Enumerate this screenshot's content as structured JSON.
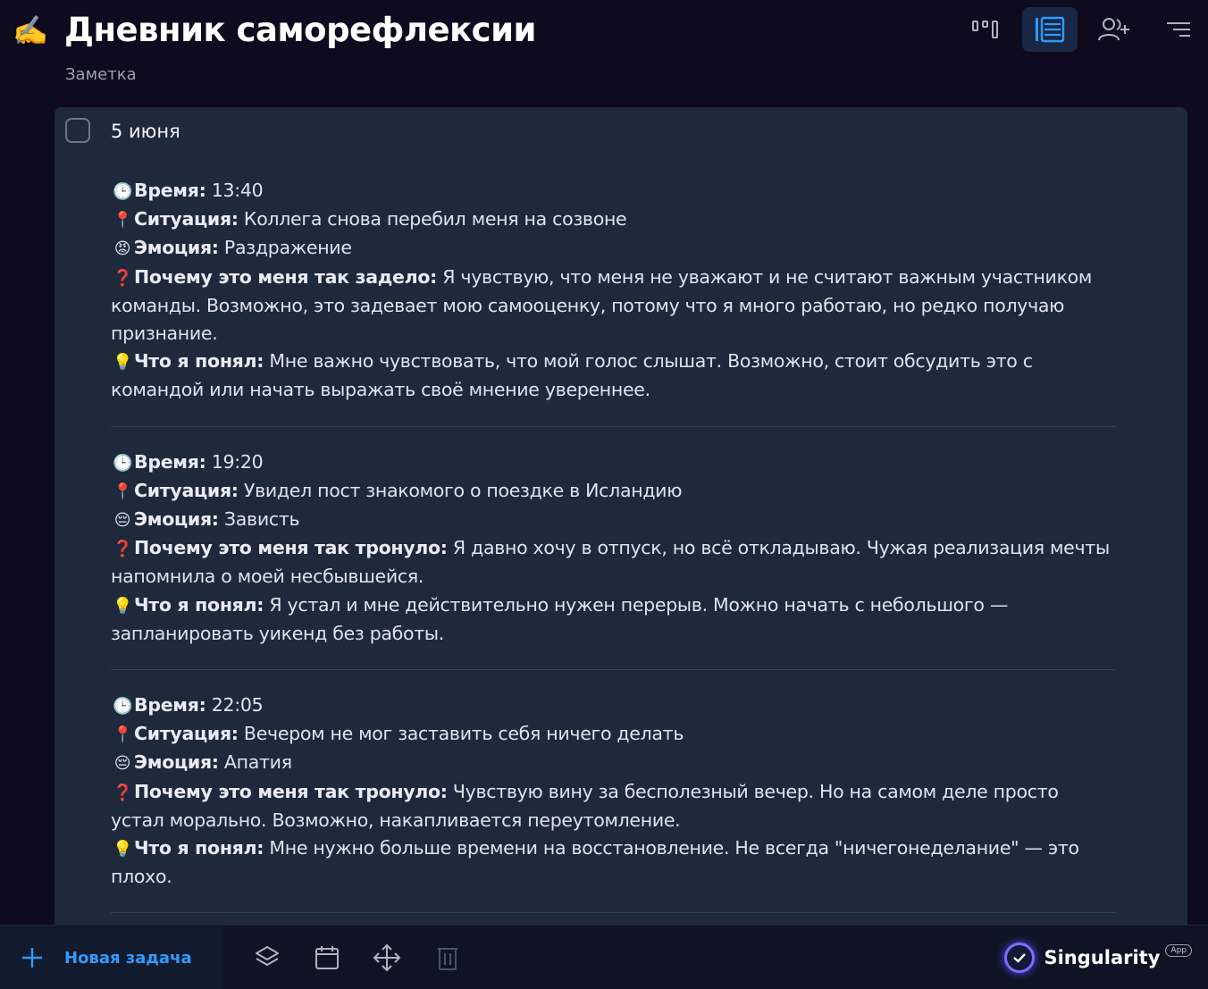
{
  "header": {
    "title_emoji": "✍️",
    "title": "Дневник саморефлексии",
    "subtitle": "Заметка"
  },
  "toolbar": {
    "icons": [
      "kanban-icon",
      "list-view-icon",
      "add-user-icon",
      "sort-icon"
    ],
    "active": "list-view-icon",
    "accent": "#2f9bff"
  },
  "note": {
    "date": "5 июня",
    "entries": [
      {
        "time_emoji": "🕒",
        "time_label": "Время:",
        "time": " 13:40",
        "situation_emoji": "📍",
        "situation_label": "Ситуация:",
        "situation": " Коллега снова перебил меня на созвоне",
        "emotion_emoji": "😡",
        "emotion_label": "Эмоция:",
        "emotion": " Раздражение",
        "why_emoji": "❓",
        "why_label": "Почему это меня так задело:",
        "why": " Я чувствую, что меня не уважают и не считают важным участником команды. Возможно, это задевает мою самооценку, потому что я много работаю, но редко получаю признание.",
        "insight_emoji": "💡",
        "insight_label": "Что я понял:",
        "insight": " Мне важно чувствовать, что мой голос слышат. Возможно, стоит обсудить это с командой или начать выражать своё мнение увереннее."
      },
      {
        "time_emoji": "🕒",
        "time_label": "Время:",
        "time": " 19:20",
        "situation_emoji": "📍",
        "situation_label": "Ситуация:",
        "situation": " Увидел пост знакомого о поездке в Исландию",
        "emotion_emoji": "😔",
        "emotion_label": "Эмоция:",
        "emotion": " Зависть",
        "why_emoji": "❓",
        "why_label": "Почему это меня так тронуло:",
        "why": " Я давно хочу в отпуск, но всё откладываю. Чужая реализация мечты напомнила о моей несбывшейся.",
        "insight_emoji": "💡",
        "insight_label": "Что я понял:",
        "insight": " Я устал и мне действительно нужен перерыв. Можно начать с небольшого — запланировать уикенд без работы."
      },
      {
        "time_emoji": "🕒",
        "time_label": "Время:",
        "time": " 22:05",
        "situation_emoji": "📍",
        "situation_label": "Ситуация:",
        "situation": " Вечером не мог заставить себя ничего делать",
        "emotion_emoji": "😔",
        "emotion_label": "Эмоция:",
        "emotion": " Апатия",
        "why_emoji": "❓",
        "why_label": "Почему это меня так тронуло:",
        "why": " Чувствую вину за бесполезный вечер. Но на самом деле просто устал морально. Возможно, накапливается переутомление.",
        "insight_emoji": "💡",
        "insight_label": "Что я понял:",
        "insight": " Мне нужно больше времени на восстановление. Не всегда \"ничегонеделание\" — это плохо."
      }
    ]
  },
  "bottombar": {
    "new_task_label": "Новая задача",
    "icons": [
      "layers-icon",
      "calendar-icon",
      "move-icon",
      "trash-icon"
    ],
    "brand_name": "Singularity",
    "brand_badge": "App"
  }
}
